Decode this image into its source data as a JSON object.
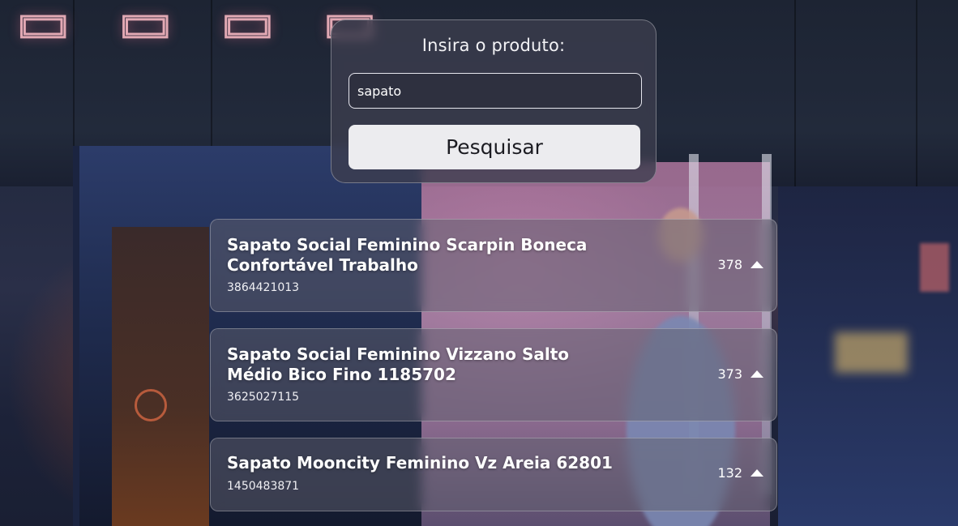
{
  "search": {
    "title": "Insira o produto:",
    "input_value": "sapato",
    "input_placeholder": "",
    "button_label": "Pesquisar"
  },
  "results": [
    {
      "title": "Sapato Social Feminino Scarpin Boneca Confortável Trabalho",
      "id": "3864421013",
      "votes": "378",
      "vote_icon": "upvote-triangle-icon"
    },
    {
      "title": "Sapato Social Feminino Vizzano Salto Médio Bico Fino 1185702",
      "id": "3625027115",
      "votes": "373",
      "vote_icon": "upvote-triangle-icon"
    },
    {
      "title": "Sapato Mooncity Feminino Vz Areia 62801",
      "id": "1450483871",
      "votes": "132",
      "vote_icon": "upvote-triangle-icon"
    }
  ],
  "colors": {
    "card_background": "#3c3e4e",
    "button_background": "#ececef",
    "button_text": "#1c1c22",
    "text": "#ffffff"
  }
}
